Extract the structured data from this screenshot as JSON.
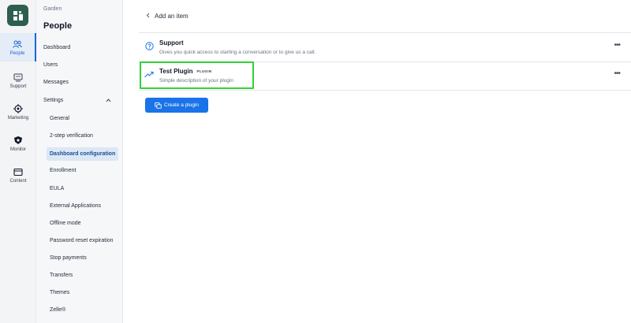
{
  "rail": {
    "items": [
      {
        "label": "People",
        "icon": "people-icon"
      },
      {
        "label": "Support",
        "icon": "support-icon"
      },
      {
        "label": "Marketing",
        "icon": "marketing-icon"
      },
      {
        "label": "Monitor",
        "icon": "monitor-icon"
      },
      {
        "label": "Content",
        "icon": "content-icon"
      }
    ]
  },
  "subnav": {
    "breadcrumb": "Garden",
    "title": "People",
    "items": {
      "dashboard": "Dashboard",
      "users": "Users",
      "messages": "Messages",
      "settings": "Settings"
    },
    "settings_items": {
      "general": "General",
      "two_step": "2-step verification",
      "dashboard_config": "Dashboard configuration",
      "enrollment": "Enrollment",
      "eula": "EULA",
      "external_apps": "External Applications",
      "offline_mode": "Offline mode",
      "password_reset": "Password reset expiration",
      "stop_payments": "Stop payments",
      "transfers": "Transfers",
      "themes": "Themes",
      "zelle": "Zelle®"
    }
  },
  "main": {
    "back_label": "Add an item",
    "items": {
      "support": {
        "name": "Support",
        "description": "Gives you quick access to starting a conversation or to give us a call.",
        "icon": "question-circle-icon"
      },
      "test_plugin": {
        "name": "Test Plugin",
        "badge": "PLUGIN",
        "description": "Simple description of your plugin",
        "icon": "trending-up-icon"
      }
    },
    "more_label": "•••",
    "create_button": "Create a plugin"
  },
  "colors": {
    "accent": "#1a73e8",
    "highlight": "#34d039",
    "logo_bg": "#2e5e4e"
  }
}
